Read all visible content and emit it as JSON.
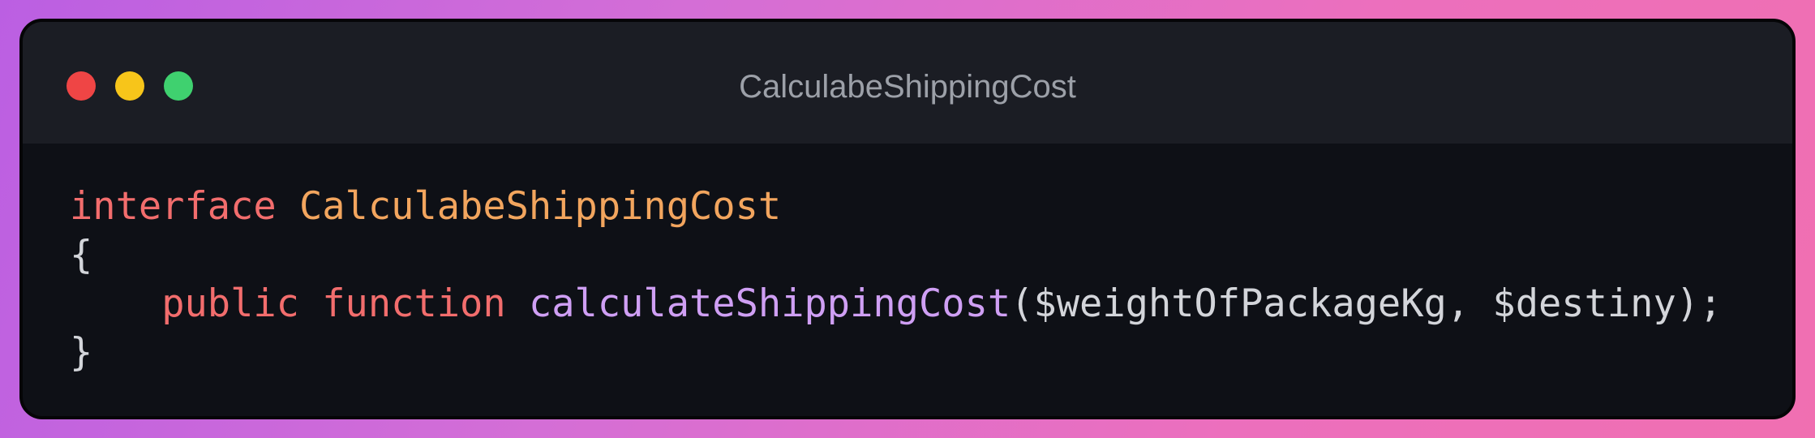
{
  "window": {
    "title": "CalculabeShippingCost",
    "controls": {
      "close_color": "#ef4545",
      "minimize_color": "#f7c51a",
      "maximize_color": "#3fd16f"
    }
  },
  "code": {
    "language": "php",
    "line1": {
      "keyword": "interface",
      "class_name": "CalculabeShippingCost"
    },
    "line2": {
      "text": "{"
    },
    "line3": {
      "indent": "    ",
      "modifier": "public",
      "keyword": "function",
      "function_name": "calculateShippingCost",
      "params": "($weightOfPackageKg, $destiny);"
    },
    "line4": {
      "text": "}"
    },
    "colors": {
      "keyword": "#f26d6d",
      "class_name": "#f2a55e",
      "function_name": "#cf9ff4",
      "plain": "#d3d5da",
      "background": "#0e1016",
      "titlebar": "#1b1d24"
    }
  }
}
